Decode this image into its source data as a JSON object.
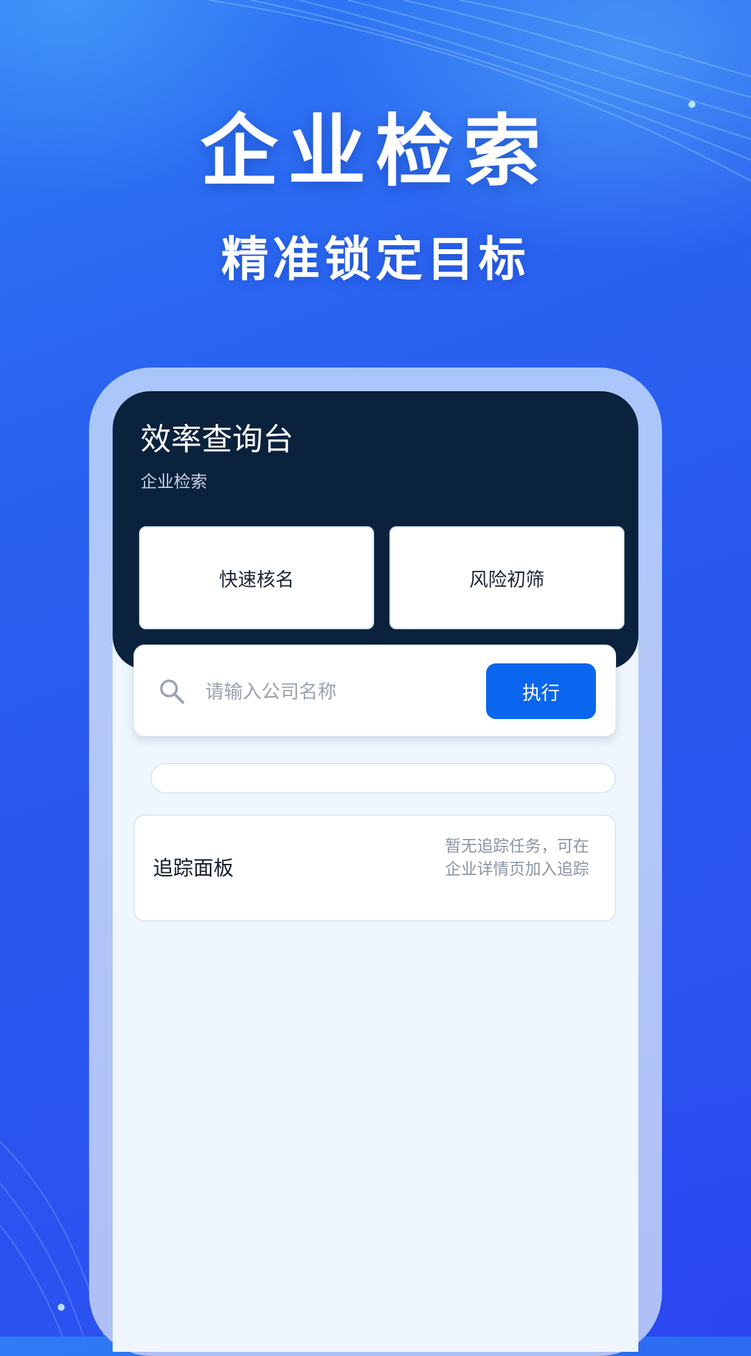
{
  "hero": {
    "title": "企业检索",
    "subtitle": "精准锁定目标"
  },
  "app": {
    "title": "效率查询台",
    "subtitle": "企业检索",
    "quick_actions": [
      {
        "label": "快速核名"
      },
      {
        "label": "风险初筛"
      }
    ],
    "search": {
      "placeholder": "请输入公司名称",
      "value": "",
      "button_label": "执行"
    },
    "tracking": {
      "title": "追踪面板",
      "empty_text": "暂无追踪任务，可在企业详情页加入追踪"
    }
  },
  "colors": {
    "background": "#2a5cf0",
    "header_bg": "#0b223d",
    "accent": "#0a66ee",
    "screen_bg": "#eff6fd"
  }
}
